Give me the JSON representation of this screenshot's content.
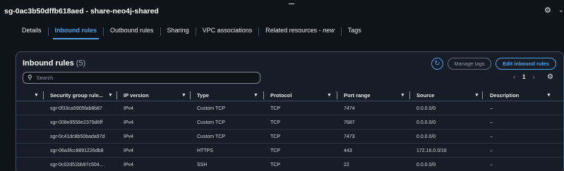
{
  "header": {
    "title": "sg-0ac3b50dffb618aed - share-neo4j-shared"
  },
  "tabs": [
    {
      "label": "Details",
      "active": false
    },
    {
      "label": "Inbound rules",
      "active": true
    },
    {
      "label": "Outbound rules",
      "active": false
    },
    {
      "label": "Sharing",
      "active": false
    },
    {
      "label": "VPC associations",
      "active": false
    },
    {
      "label": "Related resources - ",
      "suffix": "new",
      "active": false
    },
    {
      "label": "Tags",
      "active": false
    }
  ],
  "panel": {
    "title": "Inbound rules",
    "count": "(5)",
    "manage_tags": "Manage tags",
    "edit_rules": "Edit inbound rules",
    "search_placeholder": "Search",
    "page": "1"
  },
  "columns": [
    "Security group rule...",
    "IP version",
    "Type",
    "Protocol",
    "Port range",
    "Source",
    "Description"
  ],
  "rows": [
    [
      "sgr-0f33ca5905fab8b87",
      "IPv4",
      "Custom TCP",
      "TCP",
      "7474",
      "0.0.0.0/0",
      "–"
    ],
    [
      "sgr-008e9558e2379d6ff",
      "IPv4",
      "Custom TCP",
      "TCP",
      "7687",
      "0.0.0.0/0",
      "–"
    ],
    [
      "sgr-0c41dc8b50bada97d",
      "IPv4",
      "Custom TCP",
      "TCP",
      "7473",
      "0.0.0.0/0",
      "–"
    ],
    [
      "sgr-06a3fcc8891226db8",
      "IPv4",
      "HTTPS",
      "TCP",
      "443",
      "172.16.0.0/16",
      "–"
    ],
    [
      "sgr-0c02d51bb97c504...",
      "IPv4",
      "SSH",
      "TCP",
      "22",
      "0.0.0.0/0",
      "–"
    ]
  ],
  "icons": {
    "settings": "gear-icon",
    "collapse": "chevron-down-icon",
    "refresh": "refresh-icon",
    "search": "search-icon"
  },
  "colors": {
    "accent": "#539fe5",
    "background": "#0f141a",
    "panel": "#161d26"
  }
}
